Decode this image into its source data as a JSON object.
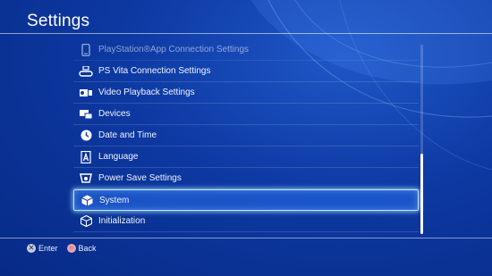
{
  "header": {
    "title": "Settings"
  },
  "menu": {
    "items": [
      {
        "label": "PlayStation®App Connection Settings",
        "icon": "smartphone-icon",
        "faded": true
      },
      {
        "label": "PS Vita Connection Settings",
        "icon": "ps-vita-icon"
      },
      {
        "label": "Video Playback Settings",
        "icon": "video-projector-icon"
      },
      {
        "label": "Devices",
        "icon": "devices-icon"
      },
      {
        "label": "Date and Time",
        "icon": "clock-icon"
      },
      {
        "label": "Language",
        "icon": "language-icon"
      },
      {
        "label": "Power Save Settings",
        "icon": "power-save-icon"
      },
      {
        "label": "System",
        "icon": "system-cube-icon",
        "selected": true
      },
      {
        "label": "Initialization",
        "icon": "initialization-icon"
      }
    ]
  },
  "footer": {
    "enter": {
      "glyph": "✕",
      "label": "Enter"
    },
    "back": {
      "glyph": "○",
      "label": "Back"
    }
  },
  "colors": {
    "background": "#0d39a2",
    "selection_border": "#bde3ff",
    "circle_button": "#b21f3a"
  },
  "scroll": {
    "position": "bottom"
  }
}
